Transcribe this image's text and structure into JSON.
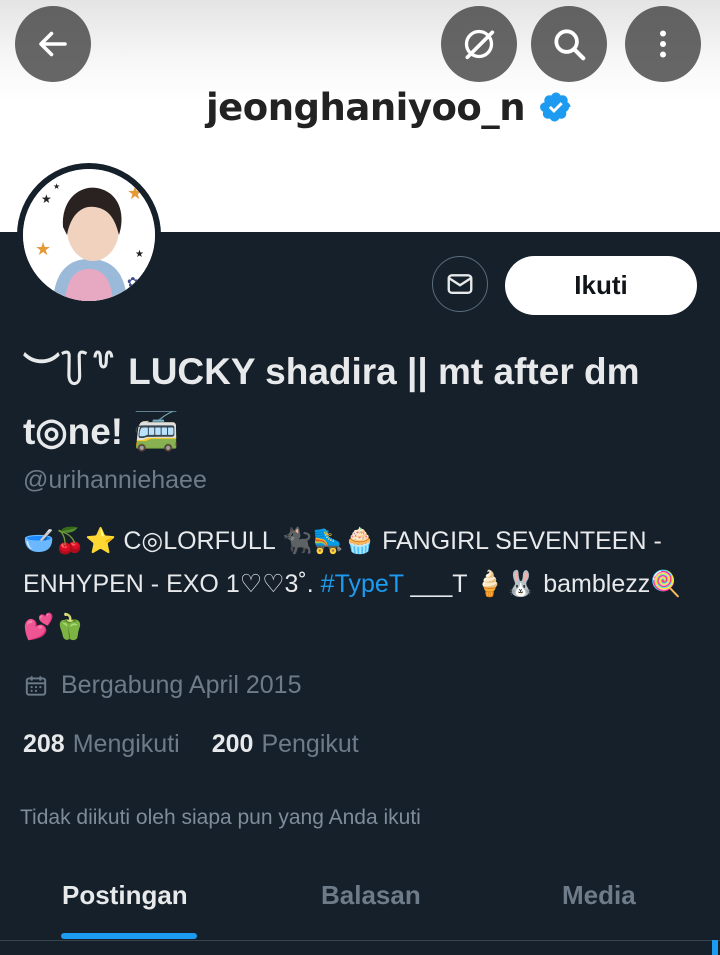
{
  "header": {
    "username": "jeonghaniyoo_n",
    "back_icon": "back-arrow-icon",
    "grok_icon": "grok-icon",
    "search_icon": "search-icon",
    "more_icon": "more-vertical-icon"
  },
  "profile": {
    "display_name": "︶꒦꒷ LUCKY shadira || mt after dm t◎ne! 🚎",
    "handle": "@urihanniehaee",
    "bio_before_hashtag": "🥣🍒⭐ C◎LORFULL 🐈‍⬛🛼🧁 FANGIRL SEVENTEEN - ENHYPEN - EXO 1♡♡3˚. ",
    "hashtag": "#TypeT",
    "bio_after_hashtag": " ___T 🍦🐰 bamblezz🍭💕🫑",
    "joined": "Bergabung April 2015",
    "following_count": "208",
    "following_label": "Mengikuti",
    "followers_count": "200",
    "followers_label": "Pengikut",
    "not_followed_text": "Tidak diikuti oleh siapa pun yang Anda ikuti"
  },
  "actions": {
    "follow_label": "Ikuti",
    "message_icon": "envelope-icon"
  },
  "tabs": [
    {
      "label": "Postingan",
      "active": true
    },
    {
      "label": "Balasan",
      "active": false
    },
    {
      "label": "Media",
      "active": false
    }
  ],
  "colors": {
    "background": "#15202b",
    "accent": "#1d9bf0",
    "secondary_text": "#6e7c89"
  }
}
